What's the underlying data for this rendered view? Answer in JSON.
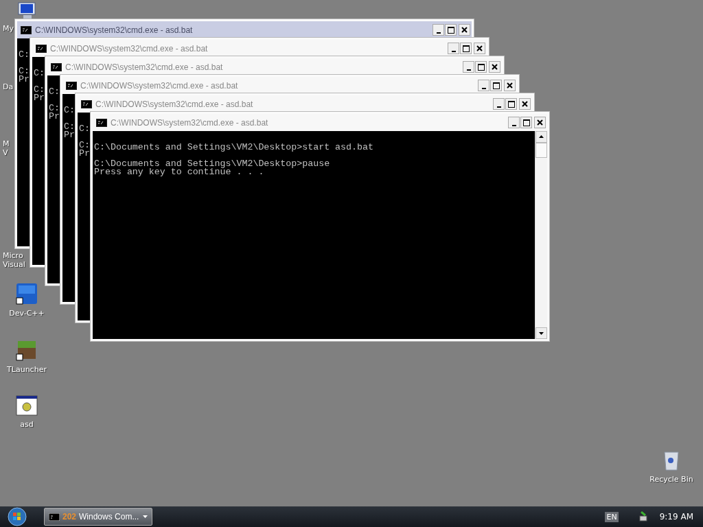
{
  "desktop_icons": [
    {
      "kind": "computer",
      "label_lines": [
        "My"
      ]
    },
    {
      "kind": "hidden",
      "label_lines": [
        "Da"
      ]
    },
    {
      "kind": "hidden",
      "label_lines": [
        "M",
        "V"
      ]
    },
    {
      "kind": "hidden",
      "label_lines": [
        "Micro",
        "Visual"
      ]
    },
    {
      "kind": "dev",
      "label_lines": [
        "Dev-C++"
      ]
    },
    {
      "kind": "block",
      "label_lines": [
        "TLauncher"
      ]
    },
    {
      "kind": "batch",
      "label_lines": [
        "asd"
      ]
    }
  ],
  "windows": [
    {
      "title": "C:\\WINDOWS\\system32\\cmd.exe - asd.bat",
      "active": true,
      "blocks": [
        [
          "C:"
        ],
        [
          "C:",
          "Pr"
        ]
      ]
    },
    {
      "title": "C:\\WINDOWS\\system32\\cmd.exe - asd.bat",
      "active": false,
      "blocks": [
        [
          "C:"
        ],
        [
          "C:",
          "Pr"
        ]
      ]
    },
    {
      "title": "C:\\WINDOWS\\system32\\cmd.exe - asd.bat",
      "active": false,
      "blocks": [
        [
          "C:"
        ],
        [
          "C:",
          "Pr"
        ]
      ]
    },
    {
      "title": "C:\\WINDOWS\\system32\\cmd.exe - asd.bat",
      "active": false,
      "blocks": [
        [
          "C:"
        ],
        [
          "C:",
          "Pr"
        ]
      ]
    },
    {
      "title": "C:\\WINDOWS\\system32\\cmd.exe - asd.bat",
      "active": false,
      "blocks": [
        [
          "C:"
        ],
        [
          "C:",
          "Pr"
        ]
      ]
    },
    {
      "title": "C:\\WINDOWS\\system32\\cmd.exe - asd.bat",
      "active": false,
      "blocks": [
        [
          "C:\\Documents and Settings\\VM2\\Desktop>start asd.bat"
        ],
        [
          "C:\\Documents and Settings\\VM2\\Desktop>pause",
          "Press any key to continue . . ."
        ]
      ]
    }
  ],
  "recycle_bin": {
    "label": "Recycle Bin"
  },
  "taskbar": {
    "task": {
      "count": "202",
      "label": "Windows Com..."
    },
    "language": "EN",
    "clock": "9:19 AM"
  }
}
